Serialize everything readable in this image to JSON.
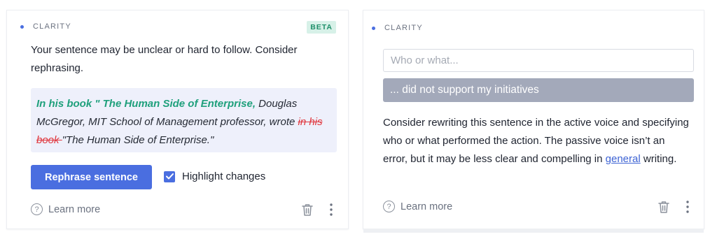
{
  "left_card": {
    "category": "CLARITY",
    "badge": "BETA",
    "description": "Your sentence may be unclear or hard to follow. Consider rephrasing.",
    "suggestion": {
      "inserted_start": "In his book \" The Human Side of Enterprise,",
      "text_middle": " Douglas McGregor, MIT School of Management professor, wrote ",
      "deleted_text": "in his book ",
      "text_end": "\"The Human Side of Enterprise.\""
    },
    "rephrase_button": "Rephrase sentence",
    "highlight_label": "Highlight changes",
    "highlight_checked": true,
    "learn_more": "Learn more"
  },
  "right_card": {
    "category": "CLARITY",
    "input_placeholder": "Who or what...",
    "sentence_end": "... did not support my initiatives",
    "description_before_link": "Consider rewriting this sentence in the active voice and specifying who or what performed the action. The passive voice isn’t an error, but it may be less clear and compelling in ",
    "link_text": "general",
    "description_after_link": " writing.",
    "learn_more": "Learn more"
  },
  "icons": {
    "help": "?",
    "delete": "trash-icon",
    "more": "more-vertical-icon"
  },
  "colors": {
    "accent": "#4a6ee0",
    "insert": "#1fa07c",
    "delete": "#e0353c",
    "badge_bg": "#d7f1e8"
  }
}
